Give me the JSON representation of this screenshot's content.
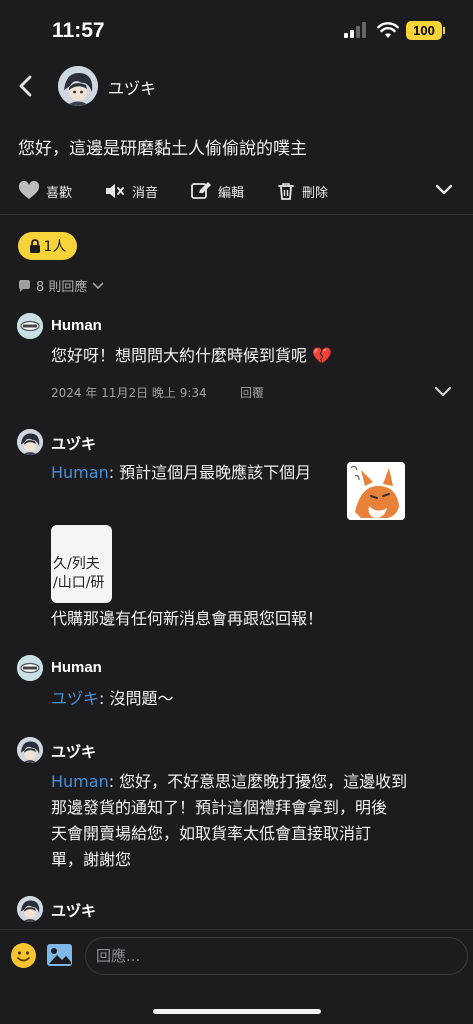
{
  "status_bar": {
    "time": "11:57",
    "battery": "100"
  },
  "header": {
    "user_name": "ユヅキ"
  },
  "post": {
    "text": "您好，這邊是研磨黏土人偷偷說的噗主"
  },
  "actions": [
    {
      "icon": "heart-icon",
      "label": "喜歡"
    },
    {
      "icon": "mute-icon",
      "label": "消音"
    },
    {
      "icon": "edit-icon",
      "label": "編輯"
    },
    {
      "icon": "trash-icon",
      "label": "刪除"
    }
  ],
  "privacy_tag": "1人",
  "replies_count": "8 則回應",
  "comments": [
    {
      "name": "Human",
      "text": "您好呀！想問問大約什麼時候到貨呢 💔",
      "date": "2024 年 11月2日 晚上 9:34",
      "reply_label": "回覆"
    },
    {
      "name": "ユヅキ",
      "mention": "Human",
      "text": ": 預計這個月最晚應該下個月",
      "attachment_lines": [
        "久/列夫",
        "/山口/研"
      ],
      "text2": "代購那邊有任何新消息會再跟您回報！"
    },
    {
      "name": "Human",
      "mention": "ユヅキ",
      "text": ": 沒問題～"
    },
    {
      "name": "ユヅキ",
      "mention": "Human",
      "text_lines": [
        ": 您好，不好意思這麼晚打擾您，這邊收到",
        "那邊發貨的通知了！預計這個禮拜會拿到，明後",
        "天會開賣場給您，如取貨率太低會直接取消訂",
        "單，謝謝您"
      ]
    },
    {
      "name": "ユヅキ"
    }
  ],
  "reply_bar": {
    "placeholder": "回應..."
  },
  "colors": {
    "background": "#1c1c1e",
    "accent": "#f7d33a",
    "mention": "#4a90d9"
  }
}
